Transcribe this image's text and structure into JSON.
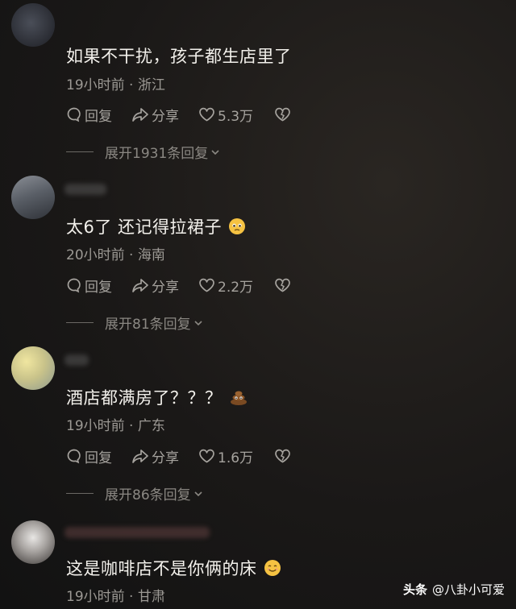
{
  "comments": [
    {
      "text": "如果不干扰，孩子都生店里了",
      "meta": "19小时前 · 浙江",
      "reply_label": "回复",
      "share_label": "分享",
      "likes": "5.3万",
      "expand": "展开1931条回复"
    },
    {
      "text": "太6了 还记得拉裙子",
      "meta": "20小时前 · 海南",
      "reply_label": "回复",
      "share_label": "分享",
      "likes": "2.2万",
      "expand": "展开81条回复"
    },
    {
      "text": "酒店都满房了？？？",
      "meta": "19小时前 · 广东",
      "reply_label": "回复",
      "share_label": "分享",
      "likes": "1.6万",
      "expand": "展开86条回复"
    },
    {
      "text": "这是咖啡店不是你俩的床",
      "meta": "19小时前 · 甘肃"
    }
  ],
  "watermark": {
    "brand": "头条",
    "account": "@八卦小可爱"
  },
  "icons": {
    "comment": "comment-bubble-icon",
    "share": "share-arrow-icon",
    "like": "heart-icon",
    "dislike": "broken-heart-icon",
    "expand": "chevron-down-icon"
  }
}
